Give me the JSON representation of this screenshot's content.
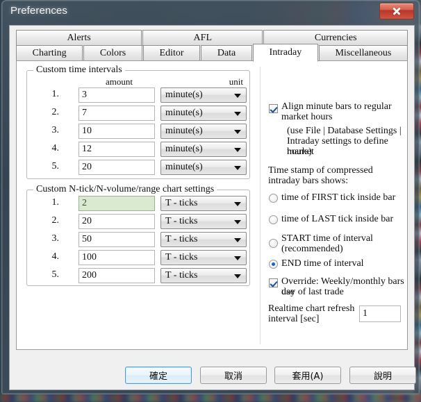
{
  "window": {
    "title": "Preferences",
    "close_label": "Close"
  },
  "tabs": {
    "row1": [
      {
        "label": "Alerts",
        "active": false
      },
      {
        "label": "AFL",
        "active": false
      },
      {
        "label": "Currencies",
        "active": false
      }
    ],
    "row2": [
      {
        "label": "Charting",
        "active": false
      },
      {
        "label": "Colors",
        "active": false
      },
      {
        "label": "Editor",
        "active": false
      },
      {
        "label": "Data",
        "active": false
      },
      {
        "label": "Intraday",
        "active": true
      },
      {
        "label": "Miscellaneous",
        "active": false
      }
    ]
  },
  "time_intervals": {
    "legend": "Custom time intervals",
    "col_amount": "amount",
    "col_unit": "unit",
    "rows": [
      {
        "index": "1.",
        "amount": "3",
        "unit": "minute(s)"
      },
      {
        "index": "2.",
        "amount": "7",
        "unit": "minute(s)"
      },
      {
        "index": "3.",
        "amount": "10",
        "unit": "minute(s)"
      },
      {
        "index": "4.",
        "amount": "12",
        "unit": "minute(s)"
      },
      {
        "index": "5.",
        "amount": "20",
        "unit": "minute(s)"
      }
    ]
  },
  "ntick_settings": {
    "legend": "Custom N-tick/N-volume/range chart settings",
    "rows": [
      {
        "index": "1.",
        "amount": "2",
        "unit": "T - ticks",
        "selected": true
      },
      {
        "index": "2.",
        "amount": "20",
        "unit": "T - ticks",
        "selected": false
      },
      {
        "index": "3.",
        "amount": "50",
        "unit": "T - ticks",
        "selected": false
      },
      {
        "index": "4.",
        "amount": "100",
        "unit": "T - ticks",
        "selected": false
      },
      {
        "index": "5.",
        "amount": "200",
        "unit": "T - ticks",
        "selected": false
      }
    ]
  },
  "right_panel": {
    "align_checkbox": {
      "label_line1": "Align minute bars to regular",
      "label_line2": "market hours",
      "checked": true
    },
    "align_note_line1": "(use File | Database Settings |",
    "align_note_line2": "Intraday settings to define market",
    "align_note_line3": "hours)",
    "timestamp_heading_line1": "Time stamp of compressed",
    "timestamp_heading_line2": "intraday bars shows:",
    "radios": [
      {
        "label_line1": "time of FIRST tick inside bar",
        "label_line2": "",
        "selected": false
      },
      {
        "label_line1": "time of LAST tick inside bar",
        "label_line2": "",
        "selected": false
      },
      {
        "label_line1": "START time of interval",
        "label_line2": "(recommended)",
        "selected": false
      },
      {
        "label_line1": "END time of interval",
        "label_line2": "",
        "selected": true
      }
    ],
    "override_checkbox": {
      "label_line1": "Override: Weekly/monthly bars use",
      "label_line2": "day of last trade",
      "checked": true
    },
    "refresh": {
      "label_line1": "Realtime chart refresh",
      "label_line2": "interval [sec]",
      "value": "1"
    }
  },
  "buttons": [
    {
      "label": "確定",
      "default": true
    },
    {
      "label": "取消",
      "default": false
    },
    {
      "label": "套用(A)",
      "default": false
    },
    {
      "label": "說明",
      "default": false
    }
  ]
}
